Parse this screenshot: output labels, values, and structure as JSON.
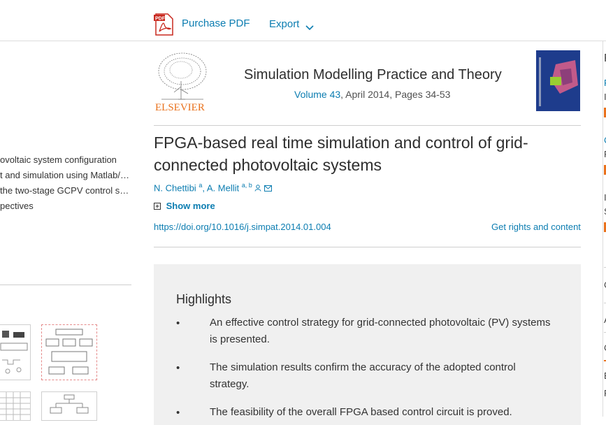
{
  "toolbar": {
    "purchase_label": "Purchase PDF",
    "export_label": "Export"
  },
  "outline": {
    "items": [
      "ovoltaic system configuration",
      "t and simulation using Matlab/…",
      "the two-stage GCPV control s…",
      "pectives"
    ]
  },
  "journal": {
    "name": "Simulation Modelling Practice and Theory",
    "volume_link": "Volume 43",
    "meta_rest": ", April 2014, Pages 34-53",
    "publisher_logo_text": "ELSEVIER"
  },
  "article": {
    "title": "FPGA-based real time simulation and control of grid-connected photovoltaic systems",
    "author1": "N. Chettibi",
    "author1_sup": "a",
    "author2": "A. Mellit",
    "author2_sup": "a, b",
    "show_more": "Show more",
    "doi": "https://doi.org/10.1016/j.simpat.2014.01.004",
    "rights": "Get rights and content"
  },
  "highlights": {
    "title": "Highlights",
    "bullet": "•",
    "items": [
      "An effective control strategy for grid-connected photovoltaic (PV) systems is presented.",
      "The simulation results confirm the accuracy of the adopted control strategy.",
      "The feasibility of the overall FPGA based control circuit is proved."
    ]
  },
  "right_sidebar": {
    "heading": "R",
    "items": [
      "F",
      "I",
      "C",
      "F",
      "I",
      "S",
      "C",
      "A",
      "C",
      "E",
      "F"
    ]
  },
  "colors": {
    "link": "#0c7db1",
    "accent_red": "#e9711c",
    "elsevier_orange": "#e9711c",
    "highlight_bg": "#f0f0f0"
  }
}
